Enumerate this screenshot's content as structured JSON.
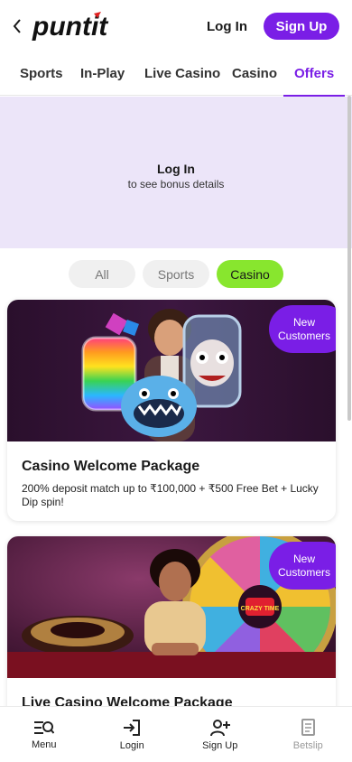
{
  "header": {
    "logo_text": "puntit",
    "login_label": "Log In",
    "signup_label": "Sign Up"
  },
  "nav": {
    "tabs": [
      {
        "label": "Sports"
      },
      {
        "label": "In-Play"
      },
      {
        "label": "Live Casino"
      },
      {
        "label": "Casino"
      },
      {
        "label": "Offers"
      }
    ],
    "active": "Offers"
  },
  "login_banner": {
    "title": "Log In",
    "subtitle": "to see bonus details"
  },
  "filters": {
    "chips": [
      {
        "label": "All"
      },
      {
        "label": "Sports"
      },
      {
        "label": "Casino"
      }
    ],
    "active": "Casino"
  },
  "offers": [
    {
      "badge_line1": "New",
      "badge_line2": "Customers",
      "title": "Casino Welcome Package",
      "description": "200% deposit match up to ₹100,000 + ₹500 Free Bet + Lucky Dip spin!"
    },
    {
      "badge_line1": "New",
      "badge_line2": "Customers",
      "title": "Live Casino Welcome Package",
      "description": "",
      "wheel_text": "CRAZY TIME"
    }
  ],
  "bottom_nav": {
    "items": [
      {
        "label": "Menu",
        "icon": "menu-search-icon"
      },
      {
        "label": "Login",
        "icon": "login-icon"
      },
      {
        "label": "Sign Up",
        "icon": "add-user-icon"
      },
      {
        "label": "Betslip",
        "icon": "betslip-icon"
      }
    ]
  },
  "colors": {
    "brand_purple": "#7a1ee6",
    "active_chip": "#88e62e",
    "banner_bg": "#ece5f9"
  }
}
